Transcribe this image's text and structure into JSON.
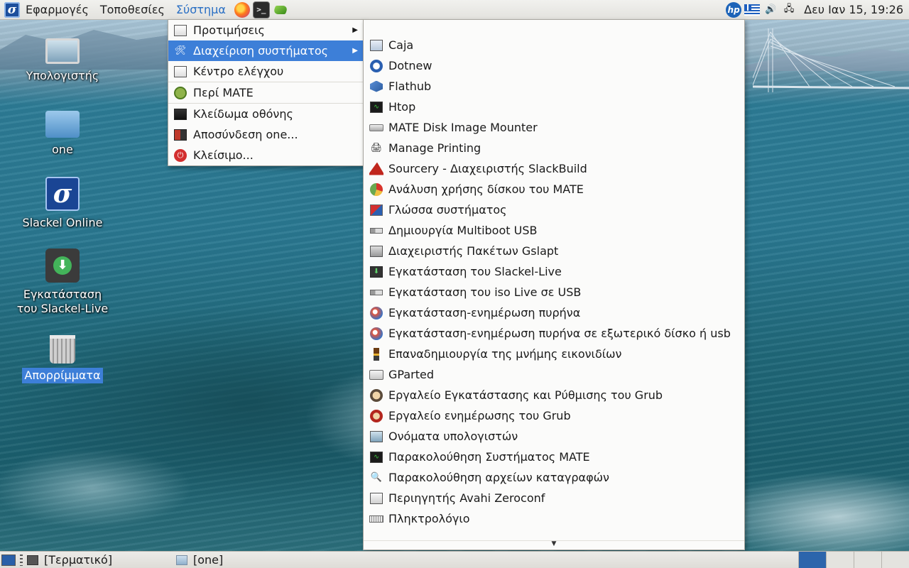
{
  "top_panel": {
    "menus": [
      "Εφαρμογές",
      "Τοποθεσίες",
      "Σύστημα"
    ],
    "active_menu": "Σύστημα",
    "launchers": [
      "firefox-icon",
      "terminal-icon",
      "leaf-icon"
    ],
    "tray_icons": [
      "hp-icon",
      "greek-flag-icon",
      "volume-icon",
      "network-icon"
    ],
    "clock": "Δευ Ιαν 15, 19:26"
  },
  "desktop": {
    "icons": [
      {
        "label": "Υπολογιστής",
        "icon": "computer-icon"
      },
      {
        "label": "one",
        "icon": "home-folder-icon"
      },
      {
        "label": "Slackel Online",
        "icon": "slackel-icon"
      },
      {
        "label": "Εγκατάσταση του Slackel-Live",
        "icon": "install-icon"
      },
      {
        "label": "Απορρίμματα",
        "icon": "trash-icon",
        "selected": true
      }
    ]
  },
  "system_menu": {
    "items": [
      {
        "label": "Προτιμήσεις",
        "icon": "preferences-icon",
        "submenu": true
      },
      {
        "label": "Διαχείριση συστήματος",
        "icon": "admin-tools-icon",
        "submenu": true,
        "highlighted": true
      },
      {
        "label": "Κέντρο ελέγχου",
        "icon": "control-center-icon"
      },
      {
        "label": "Περί MATE",
        "icon": "mate-icon"
      },
      {
        "label": "Κλείδωμα οθόνης",
        "icon": "lock-screen-icon"
      },
      {
        "label": "Αποσύνδεση one...",
        "icon": "logout-icon"
      },
      {
        "label": "Κλείσιμο...",
        "icon": "shutdown-icon"
      }
    ]
  },
  "admin_menu": {
    "items": [
      {
        "label": "Caja",
        "icon": "caja-icon"
      },
      {
        "label": "Dotnew",
        "icon": "dotnew-icon"
      },
      {
        "label": "Flathub",
        "icon": "flathub-icon"
      },
      {
        "label": "Htop",
        "icon": "htop-icon"
      },
      {
        "label": "MATE Disk Image Mounter",
        "icon": "disk-mounter-icon"
      },
      {
        "label": "Manage Printing",
        "icon": "printer-icon"
      },
      {
        "label": "Sourcery - Διαχειριστής SlackBuild",
        "icon": "wizard-hat-icon"
      },
      {
        "label": "Ανάλυση χρήσης δίσκου του MATE",
        "icon": "disk-usage-icon"
      },
      {
        "label": "Γλώσσα συστήματος",
        "icon": "language-icon"
      },
      {
        "label": "Δημιουργία Multiboot USB",
        "icon": "usb-icon"
      },
      {
        "label": "Διαχειριστής Πακέτων Gslapt",
        "icon": "package-manager-icon"
      },
      {
        "label": "Εγκατάσταση του Slackel-Live",
        "icon": "install-icon"
      },
      {
        "label": "Εγκατάσταση του iso Live σε USB",
        "icon": "usb-icon"
      },
      {
        "label": "Εγκατάσταση-ενημέρωση πυρήνα",
        "icon": "kernel-icon"
      },
      {
        "label": "Εγκατάσταση-ενημέρωση πυρήνα σε εξωτερικό δίσκο ή usb",
        "icon": "kernel-icon"
      },
      {
        "label": "Επαναδημιουργία της μνήμης εικονιδίων",
        "icon": "brush-icon"
      },
      {
        "label": "GParted",
        "icon": "gparted-icon"
      },
      {
        "label": "Εργαλείο Εγκατάστασης και Ρύθμισης του Grub",
        "icon": "grub-icon"
      },
      {
        "label": "Εργαλείο ενημέρωσης του Grub",
        "icon": "grub-update-icon"
      },
      {
        "label": "Ονόματα υπολογιστών",
        "icon": "computer-icon"
      },
      {
        "label": "Παρακολούθηση Συστήματος MATE",
        "icon": "system-monitor-icon"
      },
      {
        "label": "Παρακολούθηση αρχείων καταγραφών",
        "icon": "log-viewer-icon"
      },
      {
        "label": "Περιηγητής Avahi Zeroconf",
        "icon": "avahi-icon"
      },
      {
        "label": "Πληκτρολόγιο",
        "icon": "keyboard-icon"
      }
    ]
  },
  "bottom_panel": {
    "tasks": [
      {
        "label": "[Τερματικό]",
        "icon": "terminal-icon"
      },
      {
        "label": "[one]",
        "icon": "folder-icon"
      }
    ],
    "workspaces": 4,
    "active_workspace": 1
  }
}
